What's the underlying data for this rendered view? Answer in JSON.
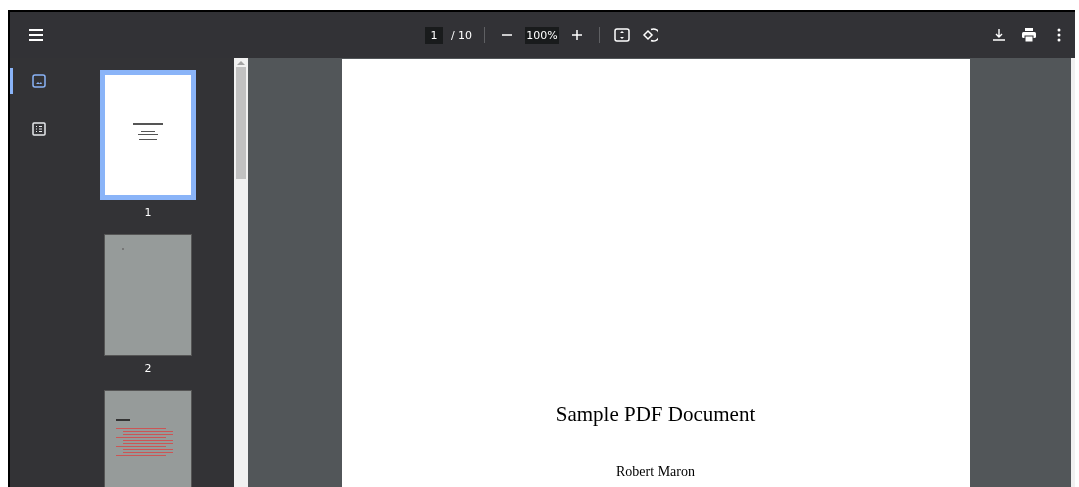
{
  "toolbar": {
    "page_input": "1",
    "page_count": "/ 10",
    "zoom": "100%"
  },
  "sidebar": {
    "views": [
      {
        "kind": "thumbnails",
        "selected": true
      },
      {
        "kind": "outline",
        "selected": false
      }
    ],
    "thumbnails": [
      {
        "kind": "title",
        "label": "1",
        "selected": true
      },
      {
        "kind": "blank",
        "label": "2",
        "selected": false
      },
      {
        "kind": "contents",
        "selected": false
      }
    ]
  },
  "document": {
    "title": "Sample PDF Document",
    "author": "Robert Maron"
  }
}
